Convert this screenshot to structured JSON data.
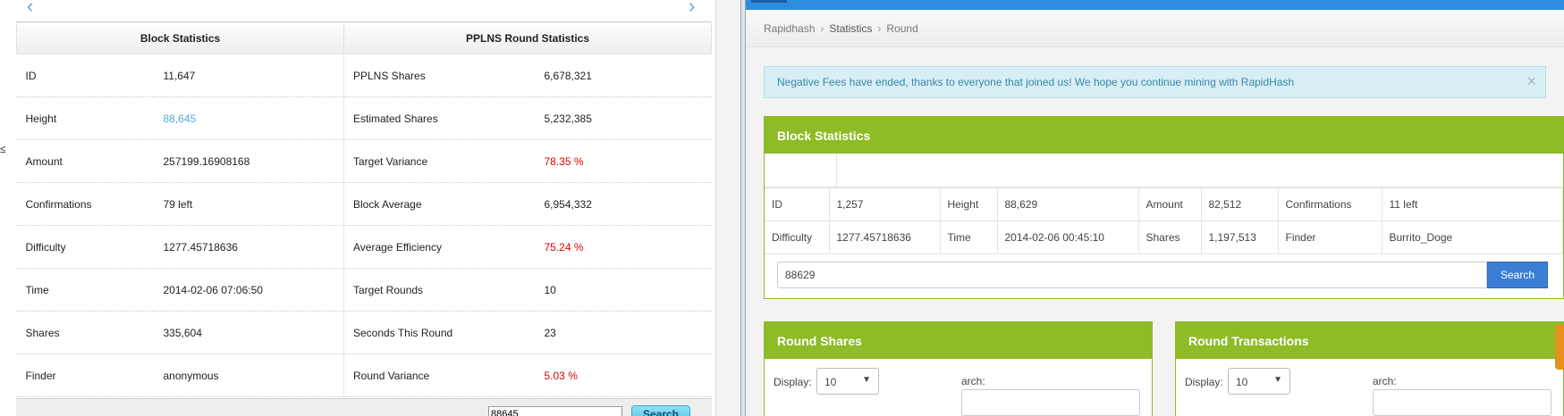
{
  "left": {
    "nav": {
      "prev": "‹",
      "next": "›"
    },
    "edge_glyph": "≤",
    "headers": [
      "Block Statistics",
      "PPLNS Round Statistics"
    ],
    "rows": [
      {
        "label": "ID",
        "value": "11,647",
        "label2": "PPLNS Shares",
        "value2": "6,678,321"
      },
      {
        "label": "Height",
        "value": "88,645",
        "label2": "Estimated Shares",
        "value2": "5,232,385"
      },
      {
        "label": "Amount",
        "value": "257199.16908168",
        "label2": "Target Variance",
        "value2": "78.35 %"
      },
      {
        "label": "Confirmations",
        "value": "79 left",
        "label2": "Block Average",
        "value2": "6,954,332"
      },
      {
        "label": "Difficulty",
        "value": "1277.45718636",
        "label2": "Average Efficiency",
        "value2": "75.24 %"
      },
      {
        "label": "Time",
        "value": "2014-02-06 07:06:50",
        "label2": "Target Rounds",
        "value2": "10"
      },
      {
        "label": "Shares",
        "value": "335,604",
        "label2": "Seconds This Round",
        "value2": "23"
      },
      {
        "label": "Finder",
        "value": "anonymous",
        "label2": "Round Variance",
        "value2": "5.03 %"
      }
    ],
    "search": {
      "value": "88645",
      "button": "Search"
    }
  },
  "right": {
    "breadcrumb": [
      "Rapidhash",
      "Statistics",
      "Round"
    ],
    "alert": {
      "text": "Negative Fees have ended, thanks to everyone that joined us! We hope you continue mining with RapidHash",
      "close": "×"
    },
    "block_panel": {
      "title": "Block Statistics",
      "row1": [
        "ID",
        "1,257",
        "Height",
        "88,629",
        "Amount",
        "82,512",
        "Confirmations",
        "11 left"
      ],
      "row2": [
        "Difficulty",
        "1277.45718636",
        "Time",
        "2014-02-06 00:45:10",
        "Shares",
        "1,197,513",
        "Finder",
        "Burrito_Doge"
      ],
      "search_value": "88629",
      "search_button": "Search"
    },
    "shares_panel": {
      "title": "Round Shares",
      "display_label": "Display:",
      "display_value": "10",
      "search_label": "arch:"
    },
    "tx_panel": {
      "title": "Round Transactions",
      "display_label": "Display:",
      "display_value": "10",
      "search_label": "arch:"
    }
  },
  "colors": {
    "accent_green": "#8dbc26",
    "accent_blue": "#3a7fd5",
    "link": "#1f7fc0",
    "red": "#e00000"
  }
}
